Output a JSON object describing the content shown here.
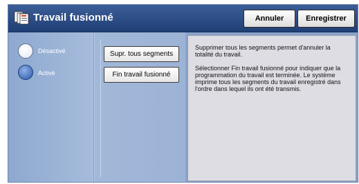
{
  "header": {
    "title": "Travail fusionné",
    "cancel_label": "Annuler",
    "save_label": "Enregistrer"
  },
  "options": {
    "disabled_label": "Désactivé",
    "enabled_label": "Activé",
    "selected": "Activé"
  },
  "actions": {
    "delete_all_label": "Supr. tous segments",
    "finish_label": "Fin travail fusionné"
  },
  "help": {
    "paragraph1": "Supprimer tous les segments permet d'annuler la totalité du travail.",
    "paragraph2": "Sélectionner Fin travail fusionné pour indiquer que la programmation du travail est terminée. Le système imprime tous les segments du travail enregistré dans l'ordre dans lequel ils ont été transmis."
  },
  "icons": {
    "app": "document-stack-icon"
  }
}
